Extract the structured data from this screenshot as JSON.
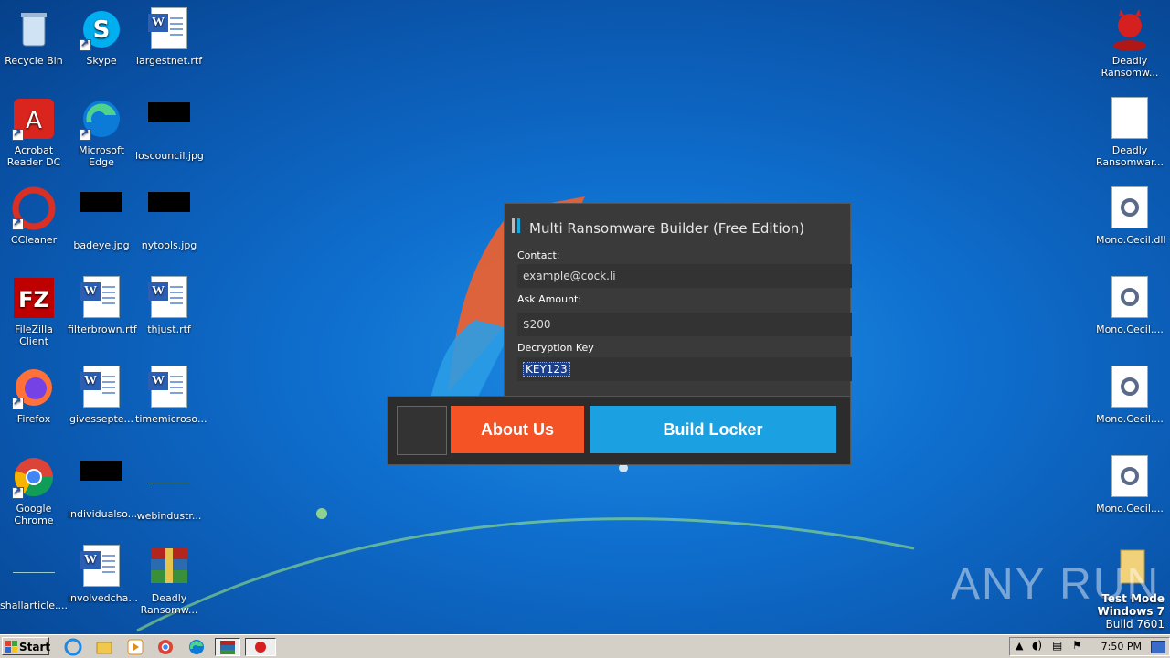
{
  "desktop": {
    "icons": [
      {
        "label": "Recycle Bin",
        "icon": "recycle-bin-icon"
      },
      {
        "label": "Skype",
        "icon": "skype-icon"
      },
      {
        "label": "largestnet.rtf",
        "icon": "word-document-icon"
      },
      {
        "label": "Acrobat Reader DC",
        "icon": "acrobat-icon"
      },
      {
        "label": "Microsoft Edge",
        "icon": "edge-icon"
      },
      {
        "label": "loscouncil.jpg",
        "icon": "image-file-icon"
      },
      {
        "label": "CCleaner",
        "icon": "ccleaner-icon"
      },
      {
        "label": "badeye.jpg",
        "icon": "image-file-icon"
      },
      {
        "label": "nytools.jpg",
        "icon": "image-file-icon"
      },
      {
        "label": "FileZilla Client",
        "icon": "filezilla-icon"
      },
      {
        "label": "filterbrown.rtf",
        "icon": "word-document-icon"
      },
      {
        "label": "thjust.rtf",
        "icon": "word-document-icon"
      },
      {
        "label": "Firefox",
        "icon": "firefox-icon"
      },
      {
        "label": "givessepte...",
        "icon": "word-document-icon"
      },
      {
        "label": "timemicroso...",
        "icon": "word-document-icon"
      },
      {
        "label": "Google Chrome",
        "icon": "chrome-icon"
      },
      {
        "label": "individualso...",
        "icon": "image-file-icon"
      },
      {
        "label": "webindustr...",
        "icon": "image-file-icon"
      },
      {
        "label": "shallarticle....",
        "icon": "image-file-icon"
      },
      {
        "label": "involvedcha...",
        "icon": "word-document-icon"
      },
      {
        "label": "Deadly Ransomw...",
        "icon": "winrar-icon"
      }
    ],
    "right_icons": [
      {
        "label": "Deadly Ransomw...",
        "icon": "devil-icon"
      },
      {
        "label": "Deadly Ransomwar...",
        "icon": "blank-file-icon"
      },
      {
        "label": "Mono.Cecil.dll",
        "icon": "dll-gear-icon"
      },
      {
        "label": "Mono.Cecil....",
        "icon": "dll-gear-icon"
      },
      {
        "label": "Mono.Cecil....",
        "icon": "dll-gear-icon"
      },
      {
        "label": "Mono.Cecil....",
        "icon": "dll-gear-icon"
      }
    ]
  },
  "builder": {
    "title": "Multi Ransomware Builder (Free Edition)",
    "contact_label": "Contact:",
    "contact_value": "example@cock.li",
    "ask_label": "Ask Amount:",
    "ask_value": "$200",
    "key_label": "Decryption Key",
    "key_value": "KEY123",
    "about_label": "About Us",
    "build_label": "Build Locker"
  },
  "watermark": {
    "test_mode": "Test Mode",
    "os": "Windows 7",
    "build": "Build 7601",
    "brand": "ANY RUN"
  },
  "taskbar": {
    "start_label": "Start",
    "clock": "7:50 PM"
  },
  "colors": {
    "about_button": "#f35325",
    "build_button": "#1ba1e2",
    "window_bg": "#3a3a3a"
  }
}
